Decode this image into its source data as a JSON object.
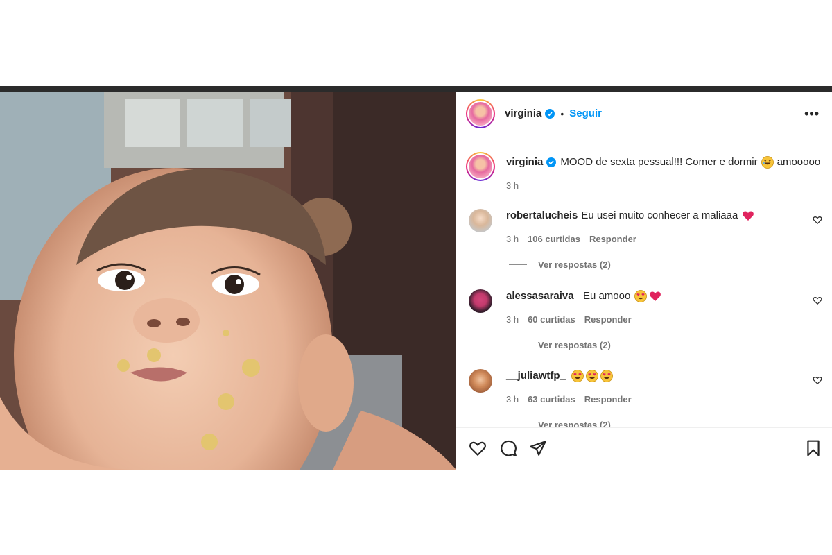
{
  "post": {
    "author": "virginia",
    "separator": "•",
    "follow_label": "Seguir",
    "more_label": "•••"
  },
  "caption": {
    "author": "virginia",
    "text": "MOOD de sexta pessual!!! Comer e dormir",
    "text_after_emoji": "amooooo",
    "time": "3 h"
  },
  "comments": [
    {
      "user": "robertalucheis",
      "text": "Eu usei muito conhecer a maliaaa",
      "time": "3 h",
      "likes": "106 curtidas",
      "reply_label": "Responder",
      "view_replies": "Ver respostas (2)"
    },
    {
      "user": "alessasaraiva_",
      "text": "Eu amooo",
      "time": "3 h",
      "likes": "60 curtidas",
      "reply_label": "Responder",
      "view_replies": "Ver respostas (2)"
    },
    {
      "user": "__juliawtfp_",
      "text": "",
      "time": "3 h",
      "likes": "63 curtidas",
      "reply_label": "Responder",
      "view_replies": "Ver respostas (2)"
    }
  ],
  "icons": {
    "like": "heart-icon",
    "comment": "comment-icon",
    "share": "share-icon",
    "save": "bookmark-icon",
    "verified": "verified-badge-icon"
  },
  "colors": {
    "accent": "#0095f6",
    "heart_emoji": "#e0245e",
    "secondary_text": "#737373"
  }
}
